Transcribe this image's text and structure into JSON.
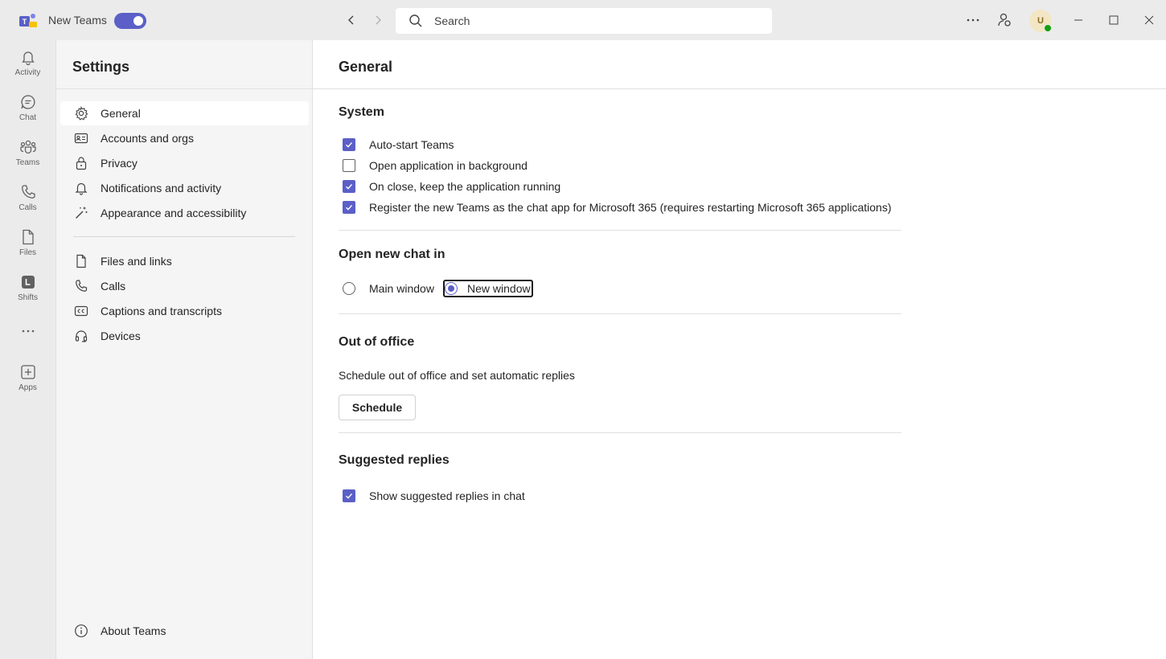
{
  "titlebar": {
    "app_name": "New Teams",
    "toggle_on": true,
    "search_placeholder": "Search",
    "avatar_initial": "U",
    "accent": "#5b5fc7"
  },
  "rail": {
    "items": [
      {
        "label": "Activity",
        "icon": "bell-icon"
      },
      {
        "label": "Chat",
        "icon": "chat-icon"
      },
      {
        "label": "Teams",
        "icon": "teams-icon"
      },
      {
        "label": "Calls",
        "icon": "phone-icon"
      },
      {
        "label": "Files",
        "icon": "file-icon"
      },
      {
        "label": "Shifts",
        "icon": "shifts-icon"
      },
      {
        "label": "Apps",
        "icon": "add-app-icon"
      }
    ]
  },
  "settings": {
    "title": "Settings",
    "menu": [
      {
        "label": "General",
        "icon": "gear-icon",
        "active": true
      },
      {
        "label": "Accounts and orgs",
        "icon": "id-card-icon"
      },
      {
        "label": "Privacy",
        "icon": "lock-icon"
      },
      {
        "label": "Notifications and activity",
        "icon": "bell-icon"
      },
      {
        "label": "Appearance and accessibility",
        "icon": "magic-wand-icon"
      },
      {
        "label": "Files and links",
        "icon": "file-icon"
      },
      {
        "label": "Calls",
        "icon": "phone-icon"
      },
      {
        "label": "Captions and transcripts",
        "icon": "cc-icon"
      },
      {
        "label": "Devices",
        "icon": "headset-icon"
      }
    ],
    "about": {
      "label": "About Teams",
      "icon": "info-icon"
    }
  },
  "content": {
    "title": "General",
    "system": {
      "title": "System",
      "options": [
        {
          "label": "Auto-start Teams",
          "checked": true
        },
        {
          "label": "Open application in background",
          "checked": false
        },
        {
          "label": "On close, keep the application running",
          "checked": true
        },
        {
          "label": "Register the new Teams as the chat app for Microsoft 365 (requires restarting Microsoft 365 applications)",
          "checked": true
        }
      ]
    },
    "open_chat": {
      "title": "Open new chat in",
      "options": [
        {
          "label": "Main window",
          "selected": false
        },
        {
          "label": "New window",
          "selected": true
        }
      ]
    },
    "out_of_office": {
      "title": "Out of office",
      "description": "Schedule out of office and set automatic replies",
      "button": "Schedule"
    },
    "suggested": {
      "title": "Suggested replies",
      "options": [
        {
          "label": "Show suggested replies in chat",
          "checked": true
        }
      ]
    }
  }
}
